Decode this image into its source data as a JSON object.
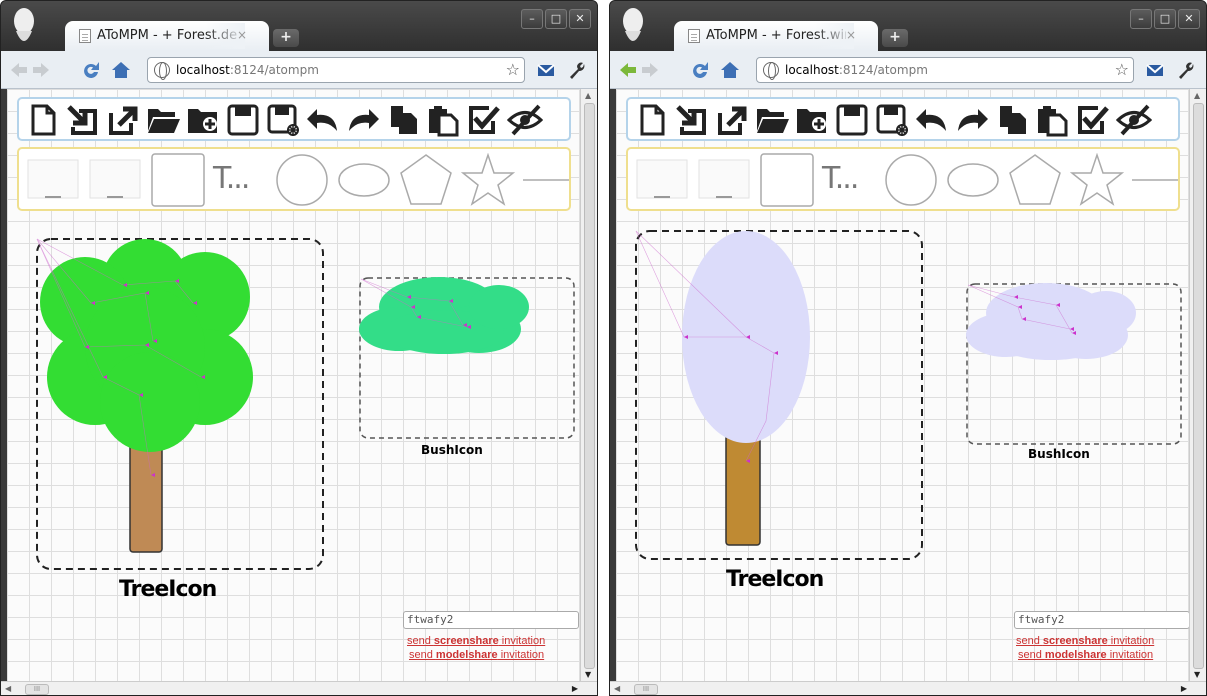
{
  "windows": [
    {
      "tab_title": "AToMPM - + Forest.defa",
      "url_host": "localhost",
      "url_rest": ":8124/atompm",
      "tree_label": "TreeIcon",
      "bush_label": "BushIcon",
      "tree_foliage_color": "#33dd33",
      "tree_trunk_color": "#bf8a55",
      "bush_color": "#33dd88",
      "collab_value": "ftwafy2",
      "invite_screen": [
        "send ",
        "screenshare",
        " invitation"
      ],
      "invite_model": [
        "send ",
        "modelshare",
        " invitation"
      ]
    },
    {
      "tab_title": "AToMPM - + Forest.wint",
      "url_host": "localhost",
      "url_rest": ":8124/atompm",
      "tree_label": "TreeIcon",
      "bush_label": "BushIcon",
      "tree_foliage_color": "#dcdcfa",
      "tree_trunk_color": "#bf8a33",
      "bush_color": "#dcdcfa",
      "collab_value": "ftwafy2",
      "invite_screen": [
        "send ",
        "screenshare",
        " invitation"
      ],
      "invite_model": [
        "send ",
        "modelshare",
        " invitation"
      ]
    }
  ],
  "tab_close_glyph": "×",
  "new_tab_glyph": "+",
  "window_controls": [
    "–",
    "□",
    "✕"
  ],
  "toolbar_main_icons": [
    "new-model-icon",
    "load-model-icon",
    "export-icon",
    "open-folder-icon",
    "new-folder-icon",
    "save-icon",
    "save-as-icon",
    "undo-icon",
    "redo-icon",
    "copy-icon",
    "paste-icon",
    "validate-icon",
    "toggle-visibility-icon"
  ],
  "toolbar_shapes_icons": [
    "image-icon-1",
    "image-icon-2",
    "rectangle-icon",
    "text-icon",
    "circle-icon",
    "ellipse-icon",
    "pentagon-icon",
    "star-icon",
    "line-icon"
  ],
  "text_tool_label": "T...",
  "accent_toolbar1_border": "#b4d3ea",
  "accent_toolbar2_border": "#efdf8e",
  "link_color": "#cc3333"
}
